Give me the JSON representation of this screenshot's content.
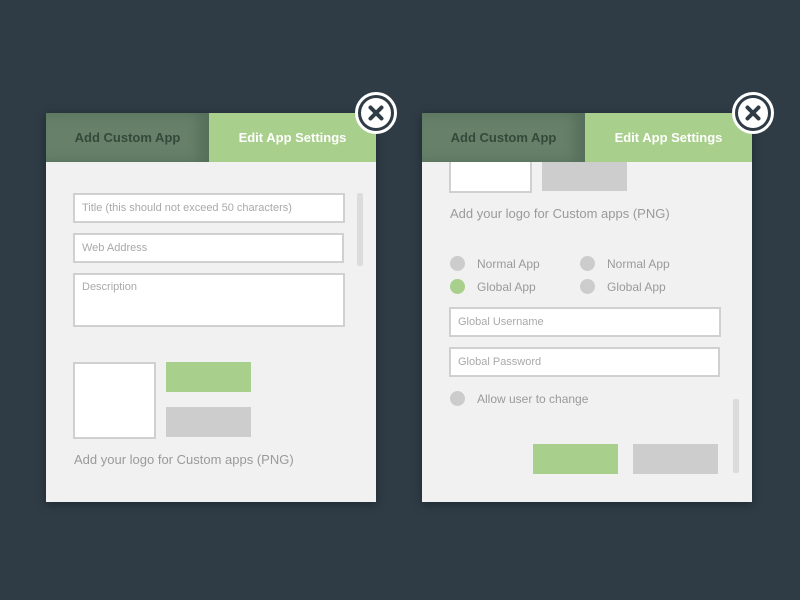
{
  "left_panel": {
    "tabs": {
      "add": "Add Custom App",
      "edit": "Edit App Settings"
    },
    "title_placeholder": "Title (this should not exceed 50 characters)",
    "web_address_placeholder": "Web Address",
    "description_placeholder": "Description",
    "logo_helper": "Add your logo for Custom apps (PNG)"
  },
  "right_panel": {
    "tabs": {
      "add": "Add Custom App",
      "edit": "Edit App Settings"
    },
    "logo_helper": "Add your logo for Custom apps (PNG)",
    "radio_groups": [
      {
        "options": [
          "Normal App",
          "Global App"
        ],
        "selected": "Global App"
      },
      {
        "options": [
          "Normal App",
          "Global App"
        ],
        "selected": ""
      }
    ],
    "global_username_placeholder": "Global Username",
    "global_password_placeholder": "Global Password",
    "allow_change_label": "Allow user to change"
  },
  "icons": {
    "close": "close-icon"
  },
  "colors": {
    "background": "#2f3c46",
    "accent_green": "#a8cf8b",
    "tab_inactive": "#66806a",
    "panel": "#f1f1f1",
    "button_gray": "#cdcdcd"
  }
}
